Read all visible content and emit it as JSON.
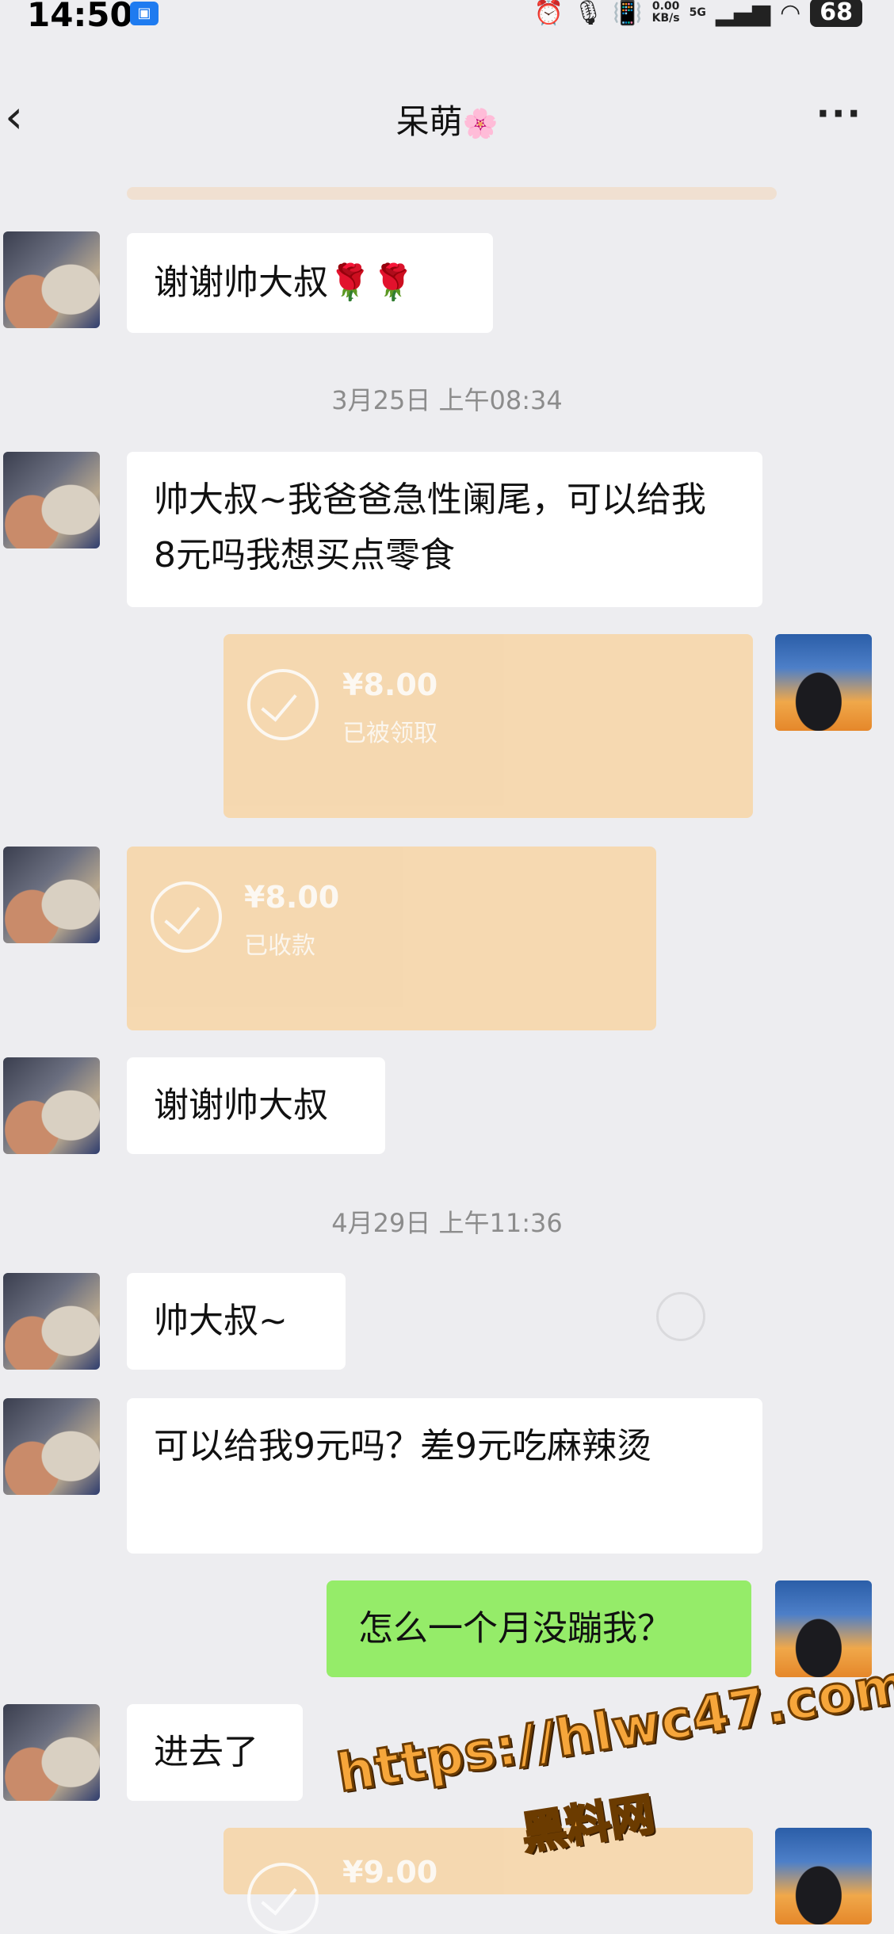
{
  "status_bar": {
    "time": "14:50",
    "net_speed_value": "0.00",
    "net_speed_unit": "KB/s",
    "network": "5G",
    "battery": "68"
  },
  "header": {
    "title": "呆萌",
    "title_emoji": "🌸",
    "back_icon": "chevron-left-icon",
    "more_icon": "more-dots-icon",
    "more_glyph": "···"
  },
  "messages": [
    {
      "side": "left",
      "type": "text",
      "text": "谢谢帅大叔🌹🌹"
    },
    {
      "type": "time",
      "text": "3月25日 上午08:34"
    },
    {
      "side": "left",
      "type": "text",
      "text": "帅大叔~我爸爸急性阑尾，可以给我8元吗我想买点零食"
    },
    {
      "side": "right",
      "type": "transfer",
      "amount": "¥8.00",
      "status": "已被领取"
    },
    {
      "side": "left",
      "type": "transfer",
      "amount": "¥8.00",
      "status": "已收款"
    },
    {
      "side": "left",
      "type": "text",
      "text": "谢谢帅大叔"
    },
    {
      "type": "time",
      "text": "4月29日 上午11:36"
    },
    {
      "side": "left",
      "type": "text",
      "text": "帅大叔~"
    },
    {
      "side": "left",
      "type": "text",
      "text": "可以给我9元吗？差9元吃麻辣烫"
    },
    {
      "side": "right",
      "type": "text",
      "text": "怎么一个月没蹦我？"
    },
    {
      "side": "left",
      "type": "text",
      "text": "进去了"
    },
    {
      "side": "right",
      "type": "transfer",
      "amount": "¥9.00",
      "status": ""
    }
  ],
  "watermark": {
    "url": "https://hlwc47.com",
    "name": "黑料网"
  },
  "colors": {
    "background": "#ededf0",
    "bubble_other": "#ffffff",
    "bubble_me": "#95ec69",
    "transfer": "#f6d7ab"
  }
}
